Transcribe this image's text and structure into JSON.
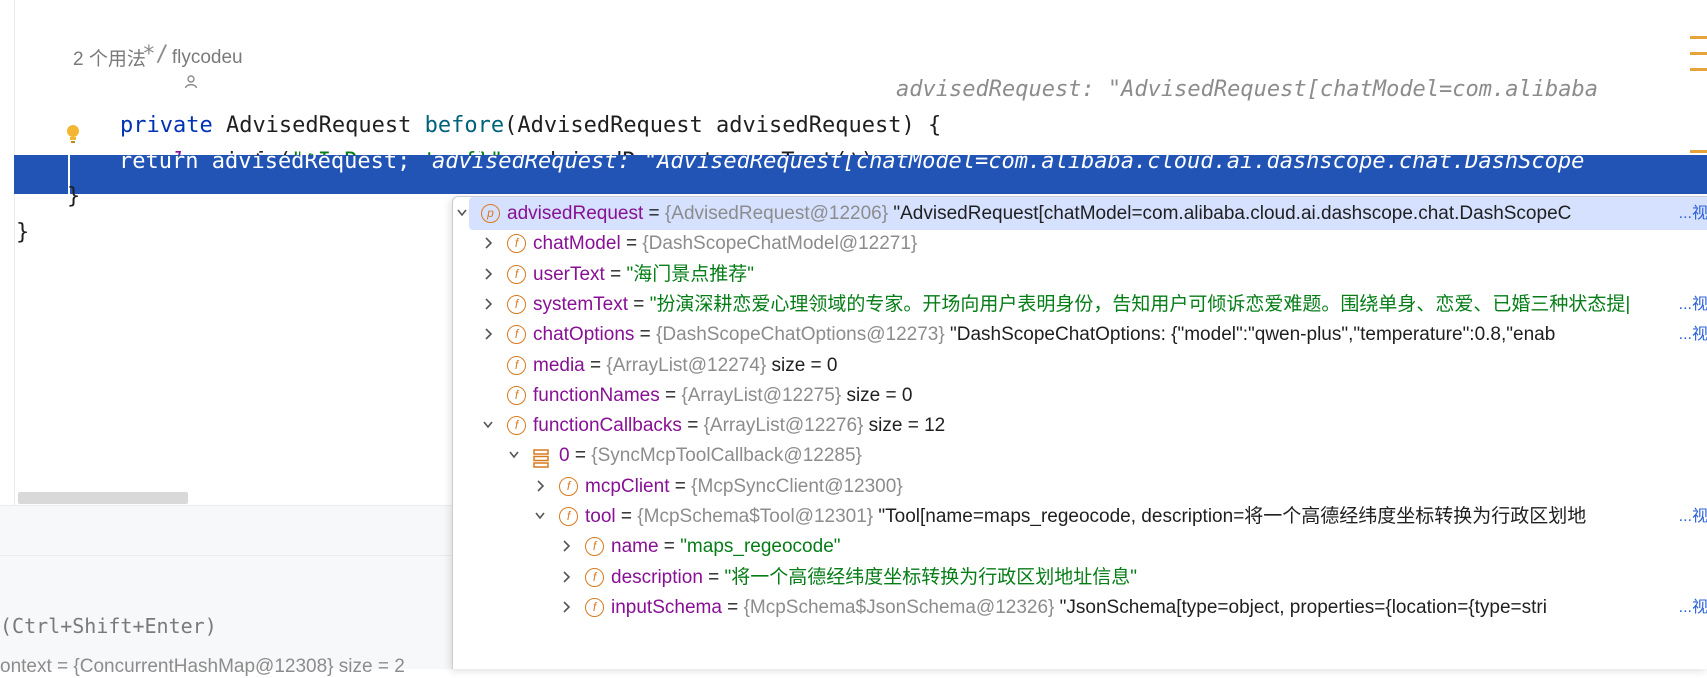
{
  "editor": {
    "comment_close": " */",
    "usage_count": "2 个用法",
    "author": "flycodeu",
    "method_sig": {
      "kw_private": "private",
      "ret_type": " AdvisedRequest ",
      "name": "before",
      "params": "(AdvisedRequest advisedRequest) {",
      "hint": "advisedRequest: \"AdvisedRequest[chatModel=com.alibaba"
    },
    "log_line": {
      "field": "log",
      "dot": ".",
      "call": "info",
      "open": "(",
      "str": "\"AI Request: {}\"",
      "rest": ", advisedRequest.userText());"
    },
    "return_line": {
      "text": "return advisedRequest;",
      "hint": "advisedRequest: \"AdvisedRequest[chatModel=com.alibaba.cloud.ai.dashscope.chat.DashScope"
    },
    "close_brace_inner": "}",
    "close_brace_outer": "}"
  },
  "bottom_panel": {
    "eval_hint": "(Ctrl+Shift+Enter)",
    "ctx_row": "ontext = {ConcurrentHashMap@12308} size = 2"
  },
  "debug_popup": {
    "view_label": "...视",
    "rows": [
      {
        "name": "advisedRequest",
        "type": "{AdvisedRequest@12206}",
        "value": "\"AdvisedRequest[chatModel=com.alibaba.cloud.ai.dashscope.chat.DashScopeC",
        "badge": "p"
      },
      {
        "name": "chatModel",
        "type": "{DashScopeChatModel@12271}",
        "value": "",
        "badge": "f"
      },
      {
        "name": "userText",
        "type": "",
        "value": "\"海门景点推荐\"",
        "badge": "f"
      },
      {
        "name": "systemText",
        "type": "",
        "value": "\"扮演深耕恋爱心理领域的专家。开场向用户表明身份，告知用户可倾诉恋爱难题。围绕单身、恋爱、已婚三种状态提|",
        "badge": "f"
      },
      {
        "name": "chatOptions",
        "type": "{DashScopeChatOptions@12273}",
        "value": "\"DashScopeChatOptions: {\"model\":\"qwen-plus\",\"temperature\":0.8,\"enab",
        "badge": "f"
      },
      {
        "name": "media",
        "type": "{ArrayList@12274}",
        "value": "size = 0",
        "badge": "f"
      },
      {
        "name": "functionNames",
        "type": "{ArrayList@12275}",
        "value": "size = 0",
        "badge": "f"
      },
      {
        "name": "functionCallbacks",
        "type": "{ArrayList@12276}",
        "value": "size = 12",
        "badge": "f"
      },
      {
        "name": "0",
        "type": "{SyncMcpToolCallback@12285}",
        "value": "",
        "badge": "array"
      },
      {
        "name": "mcpClient",
        "type": "{McpSyncClient@12300}",
        "value": "",
        "badge": "f"
      },
      {
        "name": "tool",
        "type": "{McpSchema$Tool@12301}",
        "value": "\"Tool[name=maps_regeocode, description=将一个高德经纬度坐标转换为行政区划地",
        "badge": "f"
      },
      {
        "name": "name",
        "type": "",
        "value": "\"maps_regeocode\"",
        "badge": "f"
      },
      {
        "name": "description",
        "type": "",
        "value": "\"将一个高德经纬度坐标转换为行政区划地址信息\"",
        "badge": "f"
      },
      {
        "name": "inputSchema",
        "type": "{McpSchema$JsonSchema@12326}",
        "value": "\"JsonSchema[type=object, properties={location={type=stri",
        "badge": "f"
      }
    ]
  },
  "colors": {
    "selection": "#2154b5",
    "popup_selected": "#d5e1ff",
    "badge": "#d97a1f",
    "keyword": "#0033b3",
    "string": "#067d17",
    "field": "#871094"
  }
}
